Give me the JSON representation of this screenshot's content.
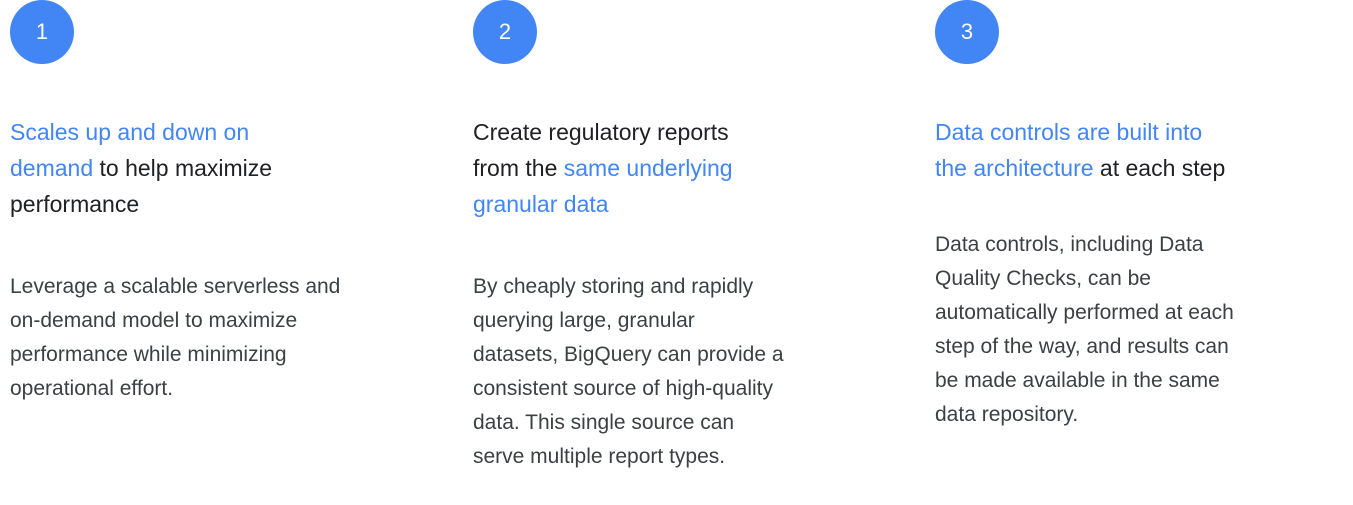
{
  "features": [
    {
      "number": "1",
      "heading": [
        {
          "text": "Scales up and down on",
          "hl": [
            {
              "t": "Scales up and down on",
              "b": true
            }
          ]
        },
        {
          "text": "demand to help maximize",
          "hl": [
            {
              "t": "demand",
              "b": true
            },
            {
              "t": " to help maximize",
              "b": false
            }
          ]
        },
        {
          "text": "performance",
          "hl": [
            {
              "t": "performance",
              "b": false
            }
          ]
        }
      ],
      "body_lines": [
        "Leverage a scalable serverless and",
        "on-demand model to maximize",
        "performance while minimizing",
        "operational effort."
      ]
    },
    {
      "number": "2",
      "heading": [
        {
          "text": "Create regulatory reports",
          "hl": [
            {
              "t": "Create regulatory reports",
              "b": false
            }
          ]
        },
        {
          "text": "from the same underlying",
          "hl": [
            {
              "t": "from the ",
              "b": false
            },
            {
              "t": "same underlying",
              "b": true
            }
          ]
        },
        {
          "text": "granular data",
          "hl": [
            {
              "t": "granular data",
              "b": true
            }
          ]
        }
      ],
      "body_lines": [
        "By cheaply storing and rapidly",
        "querying large, granular",
        "datasets, BigQuery can provide a",
        "consistent source of high-quality",
        "data. This single source can",
        "serve multiple report types."
      ]
    },
    {
      "number": "3",
      "heading": [
        {
          "text": "Data controls are built into",
          "hl": [
            {
              "t": "Data controls are built into",
              "b": true
            }
          ]
        },
        {
          "text": "the architecture at each step",
          "hl": [
            {
              "t": "the architecture",
              "b": true
            },
            {
              "t": " at each step",
              "b": false
            }
          ]
        }
      ],
      "body_lines": [
        "Data controls, including Data",
        "Quality Checks, can be",
        "automatically performed at each",
        "step of the way, and results can",
        "be made available in the same",
        "data repository."
      ]
    }
  ],
  "colors": {
    "accent": "#4285F4",
    "heading_text": "#202124",
    "body_text": "#3c4043"
  }
}
